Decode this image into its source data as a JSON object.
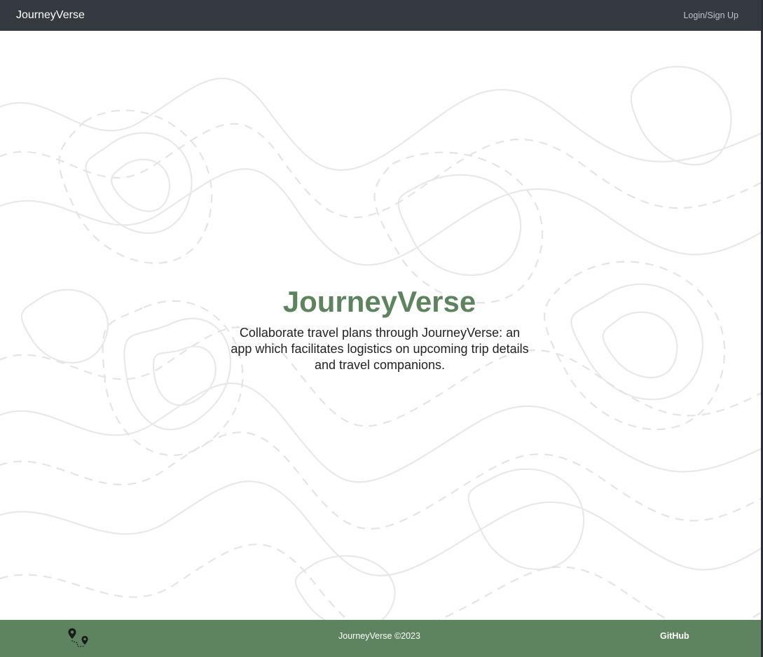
{
  "navbar": {
    "brand": "JourneyVerse",
    "login_label": "Login/Sign Up"
  },
  "hero": {
    "title": "JourneyVerse",
    "description": "Collaborate travel plans through JourneyVerse: an app which facilitates logistics on upcoming trip details and travel companions."
  },
  "footer": {
    "logo_icon": "map-route-pins-icon",
    "copyright": "JourneyVerse ©2023",
    "github_label": "GitHub"
  },
  "colors": {
    "navbar_bg": "#343a40",
    "accent_green": "#5e845f",
    "topo_lines": "#e6e6e6"
  }
}
